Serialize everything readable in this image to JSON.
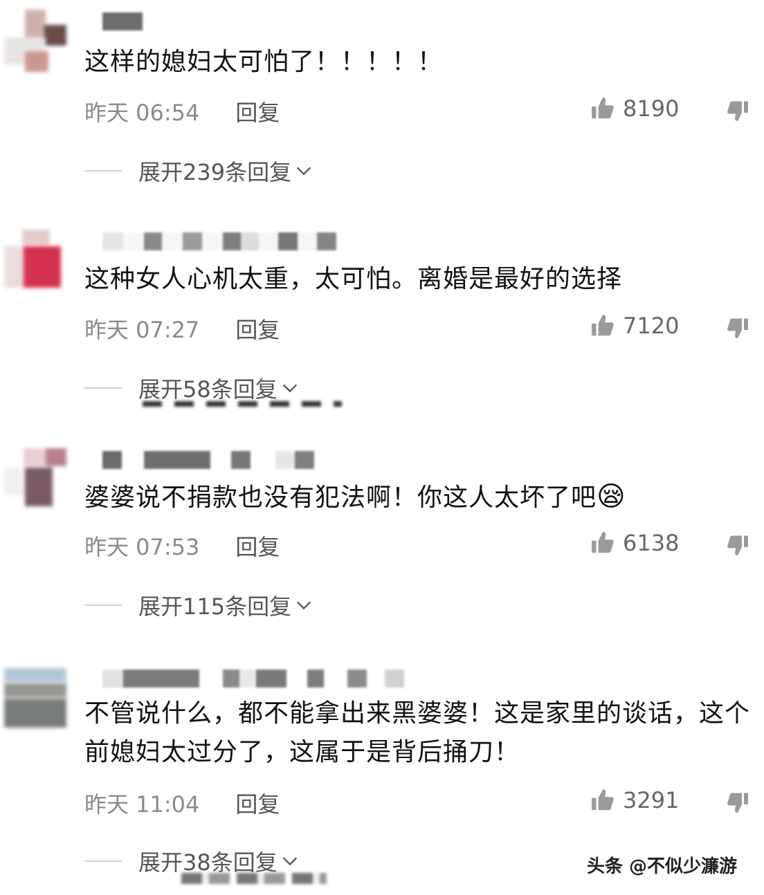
{
  "comments": [
    {
      "text": "这样的媳妇太可怕了！！！！！",
      "time": "昨天 06:54",
      "reply_label": "回复",
      "likes": "8190",
      "expand_label": "展开239条回复"
    },
    {
      "text": "这种女人心机太重，太可怕。离婚是最好的选择",
      "time": "昨天 07:27",
      "reply_label": "回复",
      "likes": "7120",
      "expand_label": "展开58条回复"
    },
    {
      "text": "婆婆说不捐款也没有犯法啊！你这人太坏了吧",
      "time": "昨天 07:53",
      "reply_label": "回复",
      "likes": "6138",
      "expand_label": "展开115条回复",
      "emoji": "😪"
    },
    {
      "text": "不管说什么，都不能拿出来黑婆婆！这是家里的谈话，这个前媳妇太过分了，这属于是背后捅刀！",
      "time": "昨天 11:04",
      "reply_label": "回复",
      "likes": "3291",
      "expand_label": "展开38条回复"
    }
  ],
  "watermark": "头条 @不似少濂游",
  "icons": {
    "like": "thumbs-up-icon",
    "dislike": "thumbs-down-icon",
    "expand": "chevron-down-icon"
  },
  "colors": {
    "text": "#111111",
    "meta": "#8a8a8a",
    "divider": "#cfcfcf"
  }
}
